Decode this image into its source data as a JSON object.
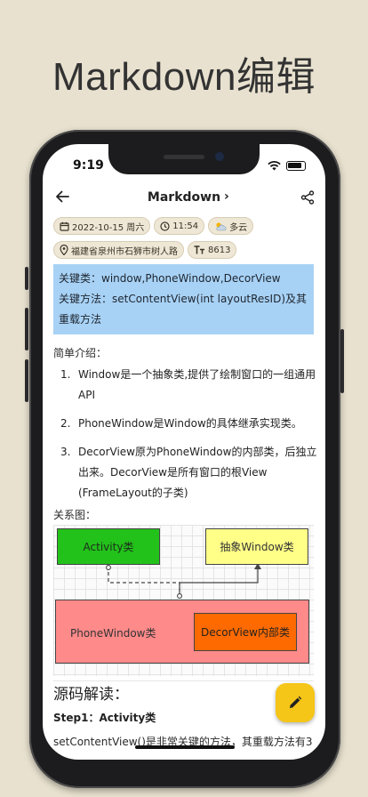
{
  "promo": {
    "title": "Markdown编辑"
  },
  "status_bar": {
    "time": "9:19"
  },
  "nav": {
    "title": "Markdown",
    "chevron": "›"
  },
  "meta": {
    "date": "2022-10-15 周六",
    "time": "11:54",
    "weather": "多云",
    "location": "福建省泉州市石狮市树人路",
    "word_count": "8613"
  },
  "content": {
    "callout": [
      "关键类：window,PhoneWindow,DecorView",
      "关键方法：setContentView(int layoutResID)及其重载方法"
    ],
    "intro_label": "简单介绍：",
    "list": [
      {
        "num": "1.",
        "text": "Window是一个抽象类,提供了绘制窗口的一组通用API"
      },
      {
        "num": "2.",
        "text": "PhoneWindow是Window的具体继承实现类。"
      },
      {
        "num": "3.",
        "text": "DecorView原为PhoneWindow的内部类，后独立出来。DecorView是所有窗口的根View (FrameLayout的子类)"
      }
    ],
    "diagram_label": "关系图：",
    "diagram": {
      "activity": "Activity类",
      "window": "抽象Window类",
      "phonewindow": "PhoneWindow类",
      "decorview": "DecorView内部类"
    },
    "section_title": "源码解读：",
    "step_title": "Step1：Activity类",
    "tail_text": "setContentView()是非常关键的方法，其重载方法有3"
  },
  "colors": {
    "background": "#e8e1cf",
    "callout": "#a8d2f5",
    "fab": "#f5c518",
    "activity_box": "#22c21a",
    "window_box": "#ffff88",
    "phonewindow_box": "#ff8a8a",
    "decorview_box": "#ff6a00"
  },
  "icons": {
    "back": "arrow-left-icon",
    "share": "share-icon",
    "date": "calendar-icon",
    "time": "clock-icon",
    "weather": "cloud-sun-icon",
    "location": "location-pin-icon",
    "word_count": "text-size-icon",
    "fab": "pencil-icon"
  }
}
